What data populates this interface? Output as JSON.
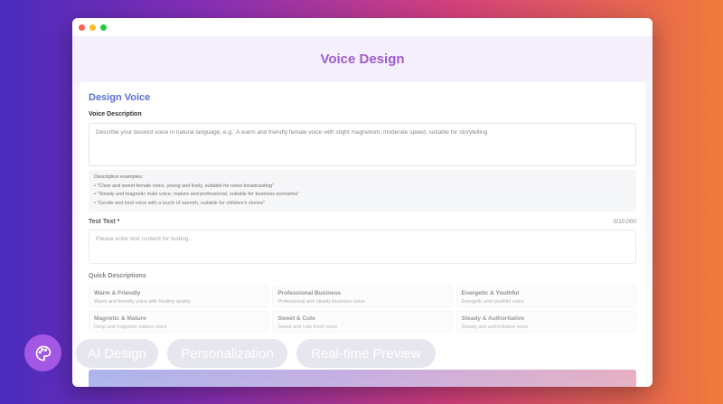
{
  "app": {
    "title": "Voice Design"
  },
  "design": {
    "title": "Design Voice",
    "description_label": "Voice Description",
    "description_placeholder": "Describe your desired voice in natural language, e.g.: A warm and friendly female voice with slight magnetism, moderate speed, suitable for storytelling",
    "examples_title": "Description examples:",
    "examples": [
      "• \"Clear and sweet female voice, young and lively, suitable for news broadcasting\"",
      "• \"Steady and magnetic male voice, mature and professional, suitable for business scenarios\"",
      "• \"Gentle and kind voice with a touch of warmth, suitable for children's stories\""
    ],
    "test_label": "Test Text *",
    "counter": "0/10,000",
    "test_placeholder": "Please enter text content for testing...",
    "quick_label": "Quick Descriptions",
    "quick": [
      {
        "title": "Warm & Friendly",
        "desc": "Warm and friendly voice with healing quality"
      },
      {
        "title": "Professional Business",
        "desc": "Professional and steady business voice"
      },
      {
        "title": "Energetic & Youthful",
        "desc": "Energetic and youthful voice"
      },
      {
        "title": "Magnetic & Mature",
        "desc": "Deep and magnetic mature voice"
      },
      {
        "title": "Sweet & Cute",
        "desc": "Sweet and cute fresh voice"
      },
      {
        "title": "Steady & Authoritative",
        "desc": "Steady and authoritative voice"
      }
    ]
  },
  "overlay": {
    "icon": "palette-icon",
    "tags": [
      "AI Design",
      "Personalization",
      "Real-time Preview"
    ]
  },
  "colors": {
    "accent": "#a25ad0",
    "card_title": "#5b6fd6",
    "palette_bg": "#a357e5"
  }
}
